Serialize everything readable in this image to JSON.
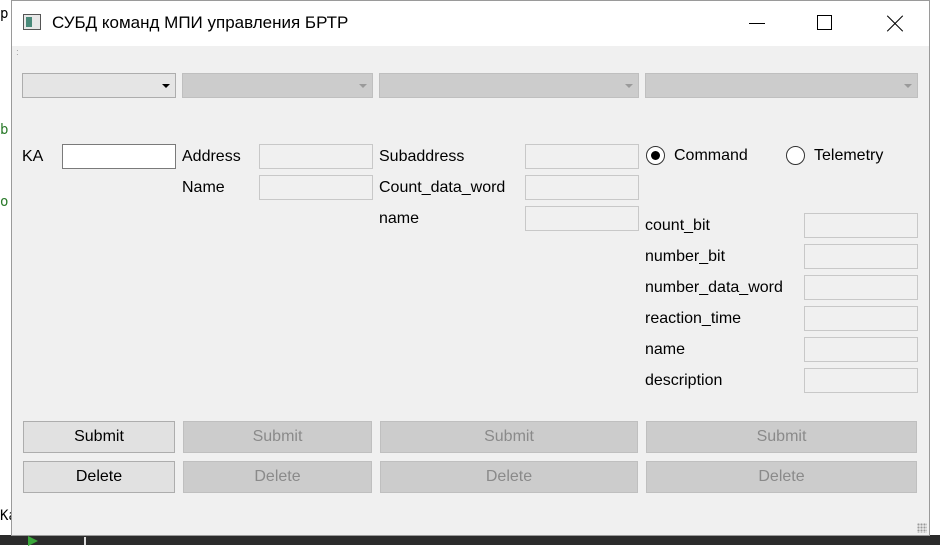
{
  "window": {
    "title": "СУБД команд МПИ управления БРТР"
  },
  "background": {
    "glyphs": [
      "p",
      "b",
      "o",
      "Ka"
    ]
  },
  "form": {
    "ka_label": "KA",
    "ka_value": "",
    "address_label": "Address",
    "name_label": "Name",
    "subaddress_label": "Subaddress",
    "count_data_word_label": "Count_data_word",
    "sub_name_label": "name",
    "radio_command": "Command",
    "radio_telemetry": "Telemetry",
    "radio_selected": "Command",
    "count_bit_label": "count_bit",
    "number_bit_label": "number_bit",
    "number_data_word_label": "number_data_word",
    "reaction_time_label": "reaction_time",
    "detail_name_label": "name",
    "description_label": "description"
  },
  "buttons": {
    "submit": "Submit",
    "delete": "Delete"
  }
}
